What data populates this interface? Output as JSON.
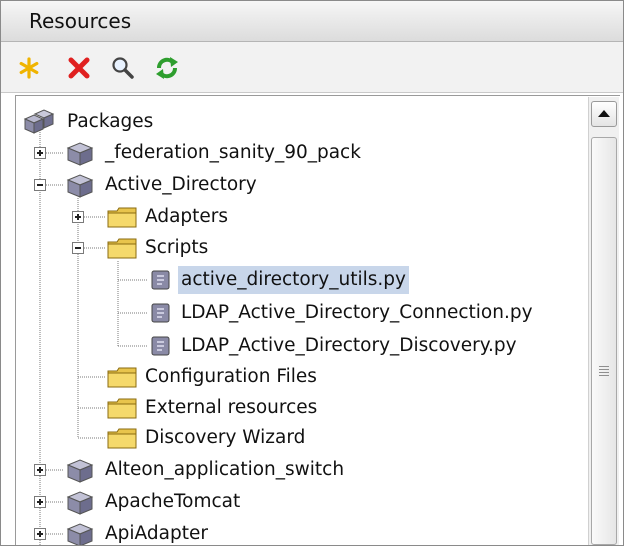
{
  "panel": {
    "title": "Resources"
  },
  "toolbar": {
    "buttons": [
      {
        "name": "new-icon",
        "color": "#f0b400"
      },
      {
        "name": "delete-icon",
        "color": "#e02020"
      },
      {
        "name": "search-icon",
        "color": "#444444"
      },
      {
        "name": "refresh-icon",
        "color": "#2e9e2e"
      }
    ]
  },
  "tree": {
    "root": {
      "label": "Packages",
      "icon": "packages-icon"
    },
    "nodes": [
      {
        "label": "_federation_sanity_90_pack",
        "icon": "package-icon",
        "expanded": false
      },
      {
        "label": "Active_Directory",
        "icon": "package-icon",
        "expanded": true,
        "children": [
          {
            "label": "Adapters",
            "icon": "folder-icon",
            "expanded": false
          },
          {
            "label": "Scripts",
            "icon": "folder-icon",
            "expanded": true,
            "children": [
              {
                "label": "active_directory_utils.py",
                "icon": "script-icon",
                "selected": true
              },
              {
                "label": "LDAP_Active_Directory_Connection.py",
                "icon": "script-icon"
              },
              {
                "label": "LDAP_Active_Directory_Discovery.py",
                "icon": "script-icon"
              }
            ]
          },
          {
            "label": "Configuration Files",
            "icon": "folder-icon"
          },
          {
            "label": "External resources",
            "icon": "folder-icon"
          },
          {
            "label": "Discovery Wizard",
            "icon": "folder-icon"
          }
        ]
      },
      {
        "label": "Alteon_application_switch",
        "icon": "package-icon",
        "expanded": false
      },
      {
        "label": "ApacheTomcat",
        "icon": "package-icon",
        "expanded": false
      },
      {
        "label": "ApiAdapter",
        "icon": "package-icon",
        "expanded": false
      }
    ]
  },
  "colors": {
    "selection": "#c8d6ea",
    "folder": "#f2cf55",
    "package": "#8c8ca8",
    "tree_line": "#7a7a7a"
  }
}
